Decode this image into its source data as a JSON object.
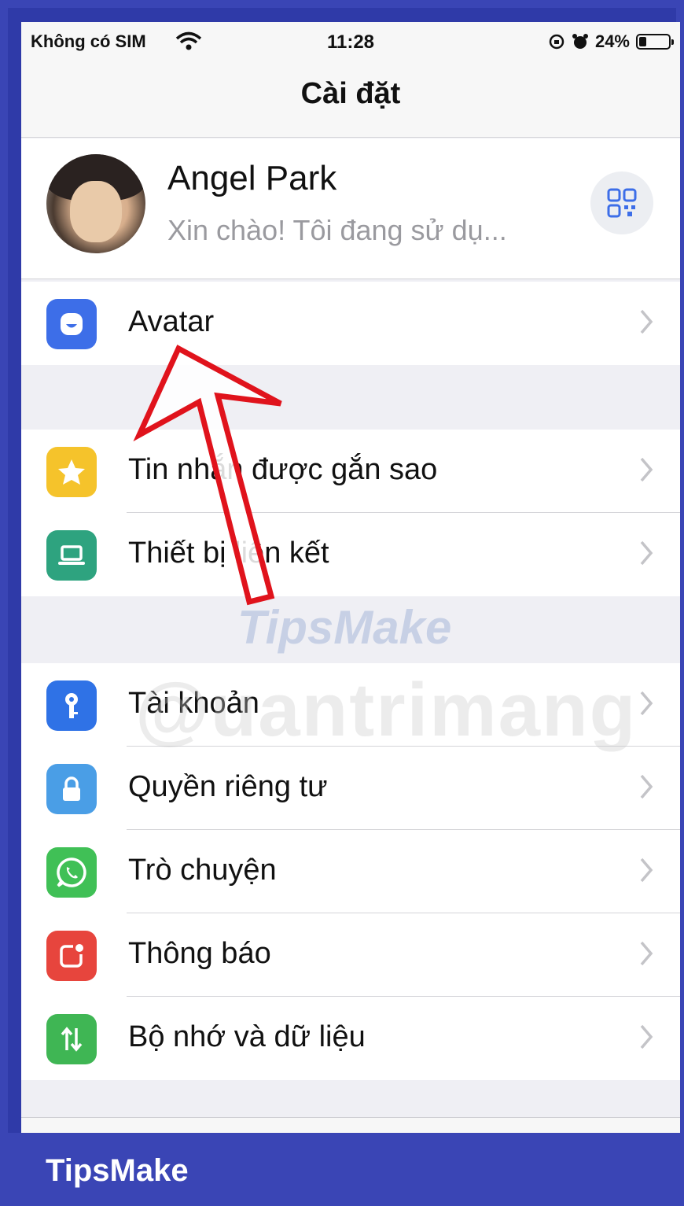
{
  "status_bar": {
    "carrier": "Không có SIM",
    "time": "11:28",
    "battery_percent": "24%",
    "battery_level": 0.24
  },
  "nav": {
    "title": "Cài đặt"
  },
  "profile": {
    "name": "Angel Park",
    "status": "Xin chào! Tôi đang sử dụ..."
  },
  "sections": [
    {
      "items": [
        {
          "label": "Avatar",
          "icon": "avatar-icon",
          "color": "#3d6ee8"
        }
      ]
    },
    {
      "items": [
        {
          "label": "Tin nhắn được gắn sao",
          "icon": "star-icon",
          "color": "#f5c32b"
        },
        {
          "label": "Thiết bị liên kết",
          "icon": "laptop-icon",
          "color": "#2ea37f"
        }
      ]
    },
    {
      "items": [
        {
          "label": "Tài khoản",
          "icon": "key-icon",
          "color": "#2f72e6"
        },
        {
          "label": "Quyền riêng tư",
          "icon": "lock-icon",
          "color": "#4a9ee6"
        },
        {
          "label": "Trò chuyện",
          "icon": "whatsapp-icon",
          "color": "#40c056"
        },
        {
          "label": "Thông báo",
          "icon": "notification-icon",
          "color": "#e7453d"
        },
        {
          "label": "Bộ nhớ và dữ liệu",
          "icon": "data-arrows-icon",
          "color": "#3fb654"
        }
      ]
    }
  ],
  "watermarks": {
    "tipsmake": "TipsMake",
    "quantrimang": "@uantrimang"
  },
  "footer": {
    "brand": "TipsMake"
  },
  "colors": {
    "frame": "#3a45b5",
    "arrow": "#e0131c",
    "chevron": "#c4c4c8"
  }
}
